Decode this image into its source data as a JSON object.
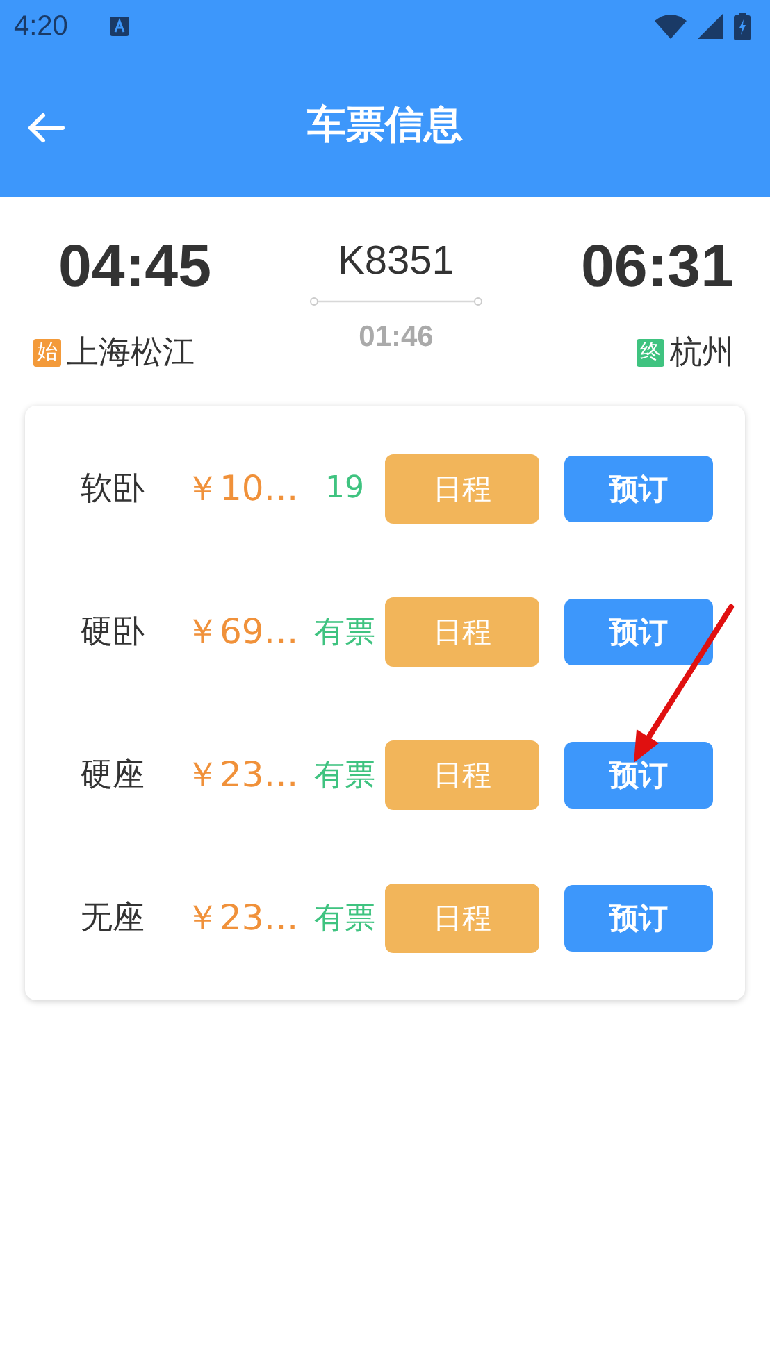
{
  "status_bar": {
    "time": "4:20"
  },
  "header": {
    "title": "车票信息"
  },
  "trip": {
    "depart_time": "04:45",
    "train": "K8351",
    "arrive_time": "06:31",
    "duration": "01:46",
    "origin": {
      "tag": "始",
      "name": "上海松江"
    },
    "destination": {
      "tag": "终",
      "name": "杭州"
    }
  },
  "seats": [
    {
      "seat": "软卧",
      "price": "￥10…",
      "availability": "19",
      "schedule_button": "日程",
      "book_button": "预订"
    },
    {
      "seat": "硬卧",
      "price": "￥69…",
      "availability": "有票",
      "schedule_button": "日程",
      "book_button": "预订"
    },
    {
      "seat": "硬座",
      "price": "￥23…",
      "availability": "有票",
      "schedule_button": "日程",
      "book_button": "预订"
    },
    {
      "seat": "无座",
      "price": "￥23…",
      "availability": "有票",
      "schedule_button": "日程",
      "book_button": "预订"
    }
  ]
}
